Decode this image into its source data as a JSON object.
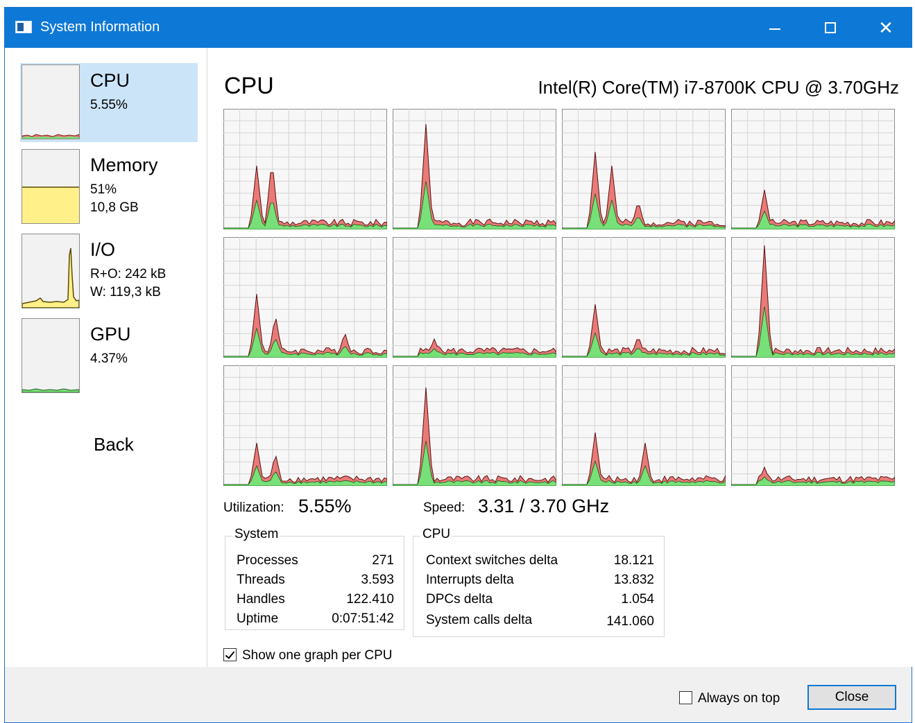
{
  "window": {
    "title": "System Information"
  },
  "sidebar": {
    "items": [
      {
        "title": "CPU",
        "line1": "5.55%",
        "line2": ""
      },
      {
        "title": "Memory",
        "line1": "51%",
        "line2": "10,8 GB"
      },
      {
        "title": "I/O",
        "line1": "R+O: 242 kB",
        "line2": "W: 119,3 kB"
      },
      {
        "title": "GPU",
        "line1": "4.37%",
        "line2": ""
      }
    ],
    "back_label": "Back"
  },
  "main": {
    "title": "CPU",
    "cpu_name": "Intel(R) Core(TM) i7-8700K CPU @ 3.70GHz",
    "utilization_label": "Utilization:",
    "utilization_value": "5.55%",
    "speed_label": "Speed:",
    "speed_value": "3.31 / 3.70 GHz",
    "system_group": {
      "title": "System",
      "rows": [
        {
          "label": "Processes",
          "value": "271"
        },
        {
          "label": "Threads",
          "value": "3.593"
        },
        {
          "label": "Handles",
          "value": "122.410"
        },
        {
          "label": "Uptime",
          "value": "0:07:51:42"
        }
      ]
    },
    "cpu_group": {
      "title": "CPU",
      "rows": [
        {
          "label": "Context switches delta",
          "value": "18.121"
        },
        {
          "label": "Interrupts delta",
          "value": "13.832"
        },
        {
          "label": "DPCs delta",
          "value": "1.054"
        },
        {
          "label": "System calls delta",
          "value": "141.060"
        }
      ]
    },
    "show_per_cpu_label": "Show one graph per CPU",
    "show_per_cpu_checked": true
  },
  "footer": {
    "always_on_top_label": "Always on top",
    "always_on_top_checked": false,
    "close_label": "Close"
  },
  "colors": {
    "titlebar": "#0e78d6",
    "selected": "#cce4f7",
    "kernel_fill": "#e87a78",
    "user_fill": "#78e078",
    "memory_fill": "#fff08a"
  }
}
